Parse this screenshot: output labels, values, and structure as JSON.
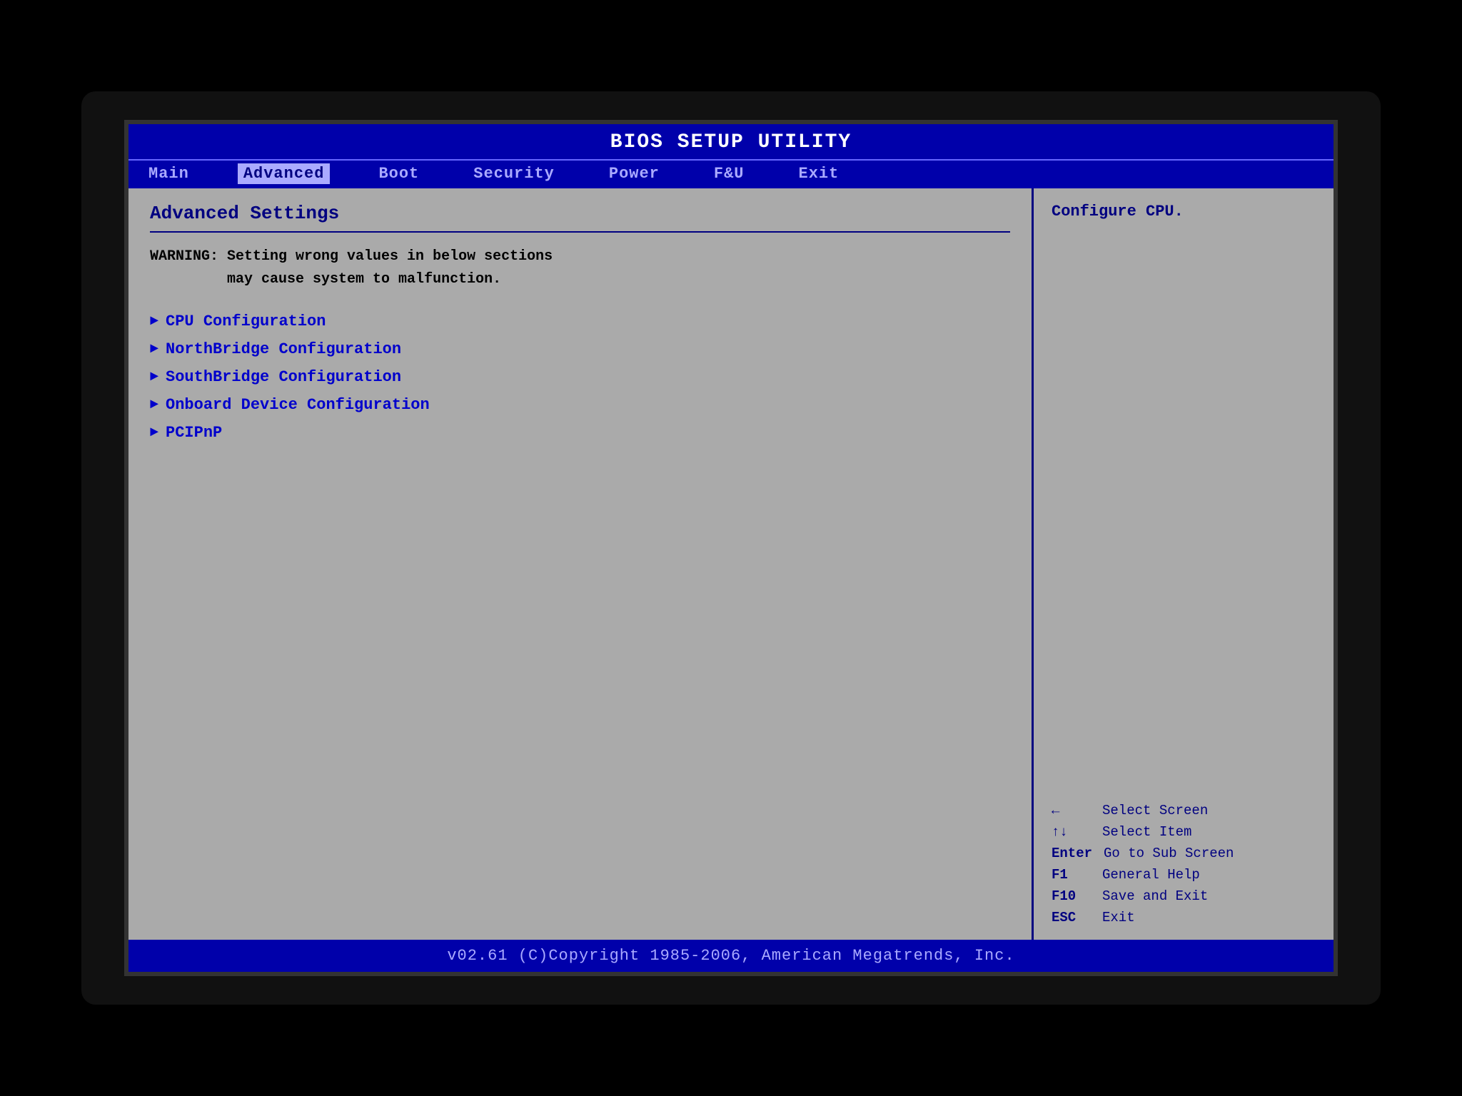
{
  "title": "BIOS SETUP UTILITY",
  "menu": {
    "items": [
      {
        "label": "Main",
        "active": false
      },
      {
        "label": "Advanced",
        "active": true
      },
      {
        "label": "Boot",
        "active": false
      },
      {
        "label": "Security",
        "active": false
      },
      {
        "label": "Power",
        "active": false
      },
      {
        "label": "F&U",
        "active": false
      },
      {
        "label": "Exit",
        "active": false
      }
    ]
  },
  "left_panel": {
    "section_title": "Advanced Settings",
    "warning": "WARNING: Setting wrong values in below sections\n         may cause system to malfunction.",
    "entries": [
      {
        "label": "CPU Configuration"
      },
      {
        "label": "NorthBridge Configuration"
      },
      {
        "label": "SouthBridge Configuration"
      },
      {
        "label": "Onboard Device Configuration"
      },
      {
        "label": "PCIPnP"
      }
    ]
  },
  "right_panel": {
    "help_text": "Configure CPU.",
    "key_hints": [
      {
        "key": "←",
        "desc": "Select Screen"
      },
      {
        "key": "↑↓",
        "desc": "Select Item"
      },
      {
        "key": "Enter",
        "desc": "Go to Sub Screen"
      },
      {
        "key": "F1",
        "desc": "General Help"
      },
      {
        "key": "F10",
        "desc": "Save and Exit"
      },
      {
        "key": "ESC",
        "desc": "Exit"
      }
    ]
  },
  "footer": "v02.61 (C)Copyright 1985-2006, American Megatrends, Inc."
}
